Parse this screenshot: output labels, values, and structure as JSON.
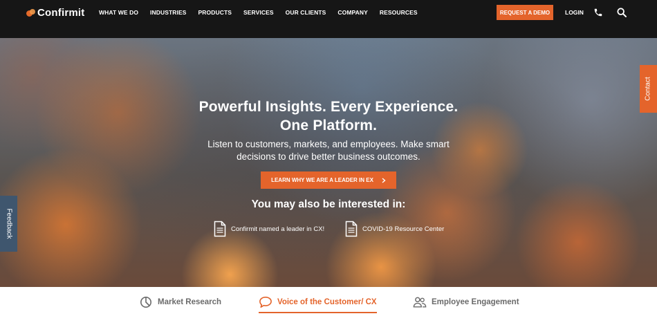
{
  "header": {
    "logo_text": "Confirmit",
    "menu": [
      "WHAT WE DO",
      "INDUSTRIES",
      "PRODUCTS",
      "SERVICES",
      "OUR CLIENTS",
      "COMPANY",
      "RESOURCES"
    ],
    "demo_button": "REQUEST A DEMO",
    "login": "LOGIN",
    "icons": [
      "phone-icon",
      "search-icon"
    ]
  },
  "hero": {
    "headline_line1": "Powerful Insights. Every Experience.",
    "headline_line2": "One Platform.",
    "subtext_line1": "Listen to customers, markets, and employees. Make smart",
    "subtext_line2": "decisions to drive better business outcomes.",
    "cta": "LEARN WHY WE ARE A LEADER IN EX",
    "interested_heading": "You may also be interested in:",
    "resources": [
      "Confirmit named a leader in CX!",
      "COVID-19 Resource Center"
    ]
  },
  "side_tabs": {
    "contact": "Contact",
    "feedback": "Feedback"
  },
  "bottom_tabs": [
    {
      "label": "Market Research",
      "icon": "pie-chart-icon",
      "active": false
    },
    {
      "label": "Voice of the Customer/ CX",
      "icon": "speech-bubble-icon",
      "active": true
    },
    {
      "label": "Employee Engagement",
      "icon": "people-icon",
      "active": false
    }
  ],
  "colors": {
    "accent": "#e4642b",
    "nav_bg": "#161616",
    "feedback_bg": "#3f566e",
    "tab_text": "#6b6b6b"
  }
}
